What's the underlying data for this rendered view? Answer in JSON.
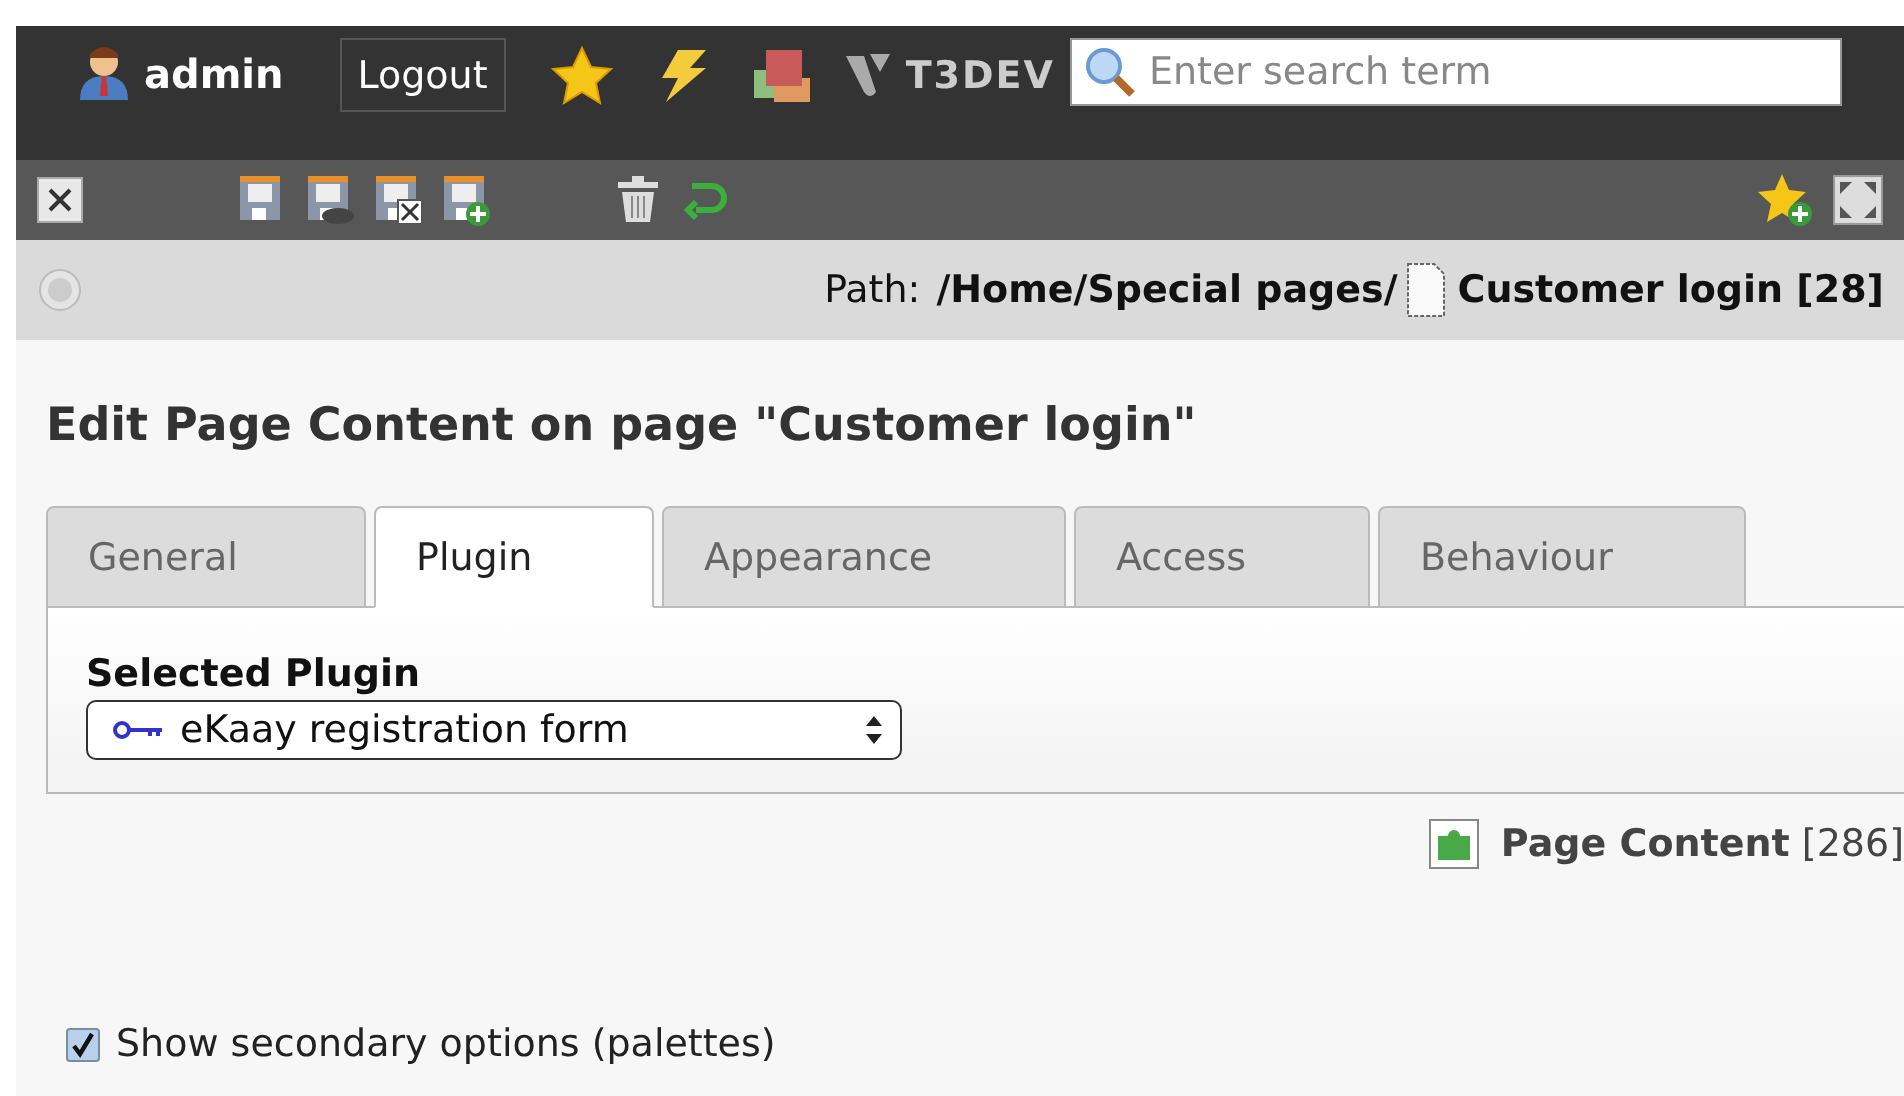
{
  "topbar": {
    "user": "admin",
    "logout": "Logout",
    "site": "T3DEV",
    "search": {
      "placeholder": "Enter search term"
    }
  },
  "path": {
    "label": "Path:",
    "trail": "/Home/Special pages/",
    "page": "Customer login [28]"
  },
  "heading": "Edit Page Content on page \"Customer login\"",
  "tabs": [
    {
      "label": "General",
      "selected": false
    },
    {
      "label": "Plugin",
      "selected": true
    },
    {
      "label": "Appearance",
      "selected": false
    },
    {
      "label": "Access",
      "selected": false
    },
    {
      "label": "Behaviour",
      "selected": false
    }
  ],
  "plugin": {
    "label": "Selected Plugin",
    "value": "eKaay registration form"
  },
  "record": {
    "title": "Page Content",
    "id": "[286]"
  },
  "secondary_options": {
    "label": "Show secondary options (palettes)",
    "checked": true
  }
}
